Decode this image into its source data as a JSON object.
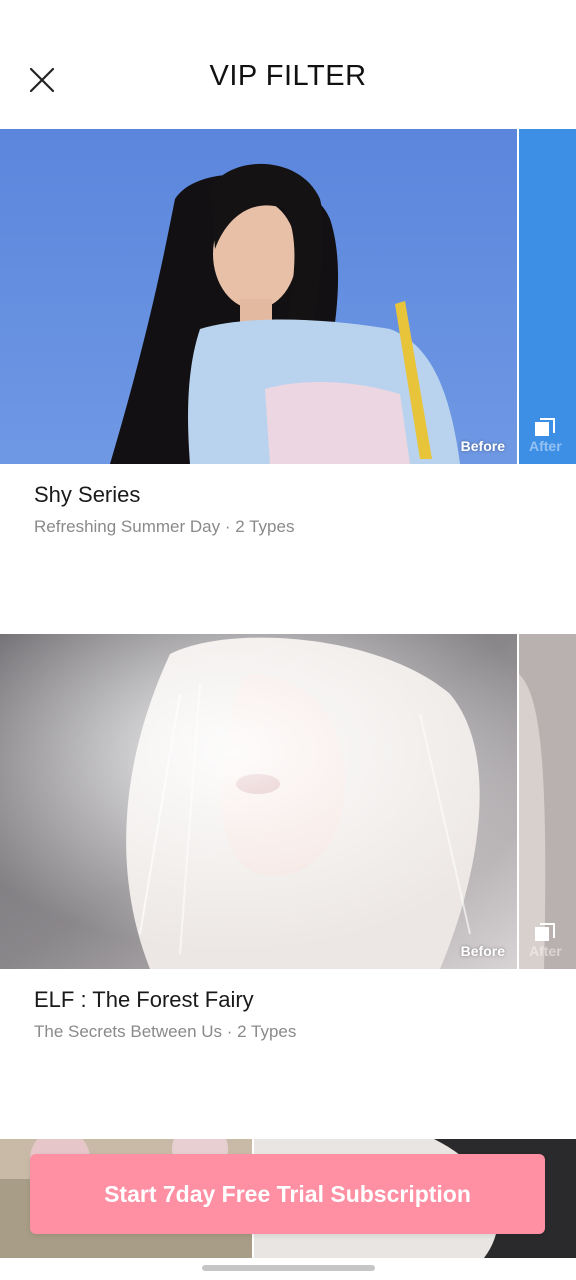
{
  "header": {
    "title": "VIP FILTER",
    "close_icon": "close-icon"
  },
  "filters": [
    {
      "title": "Shy Series",
      "subtitle": "Refreshing Summer Day · 2 Types",
      "before_label": "Before",
      "after_label": "After"
    },
    {
      "title": "ELF : The Forest Fairy",
      "subtitle": "The Secrets Between Us · 2 Types",
      "before_label": "Before",
      "after_label": "After"
    }
  ],
  "cta": {
    "label": "Start 7day Free Trial Subscription"
  },
  "colors": {
    "accent": "#ff8fa3",
    "title_text": "#1a1a1a",
    "subtitle_text": "#8a8a8a"
  }
}
